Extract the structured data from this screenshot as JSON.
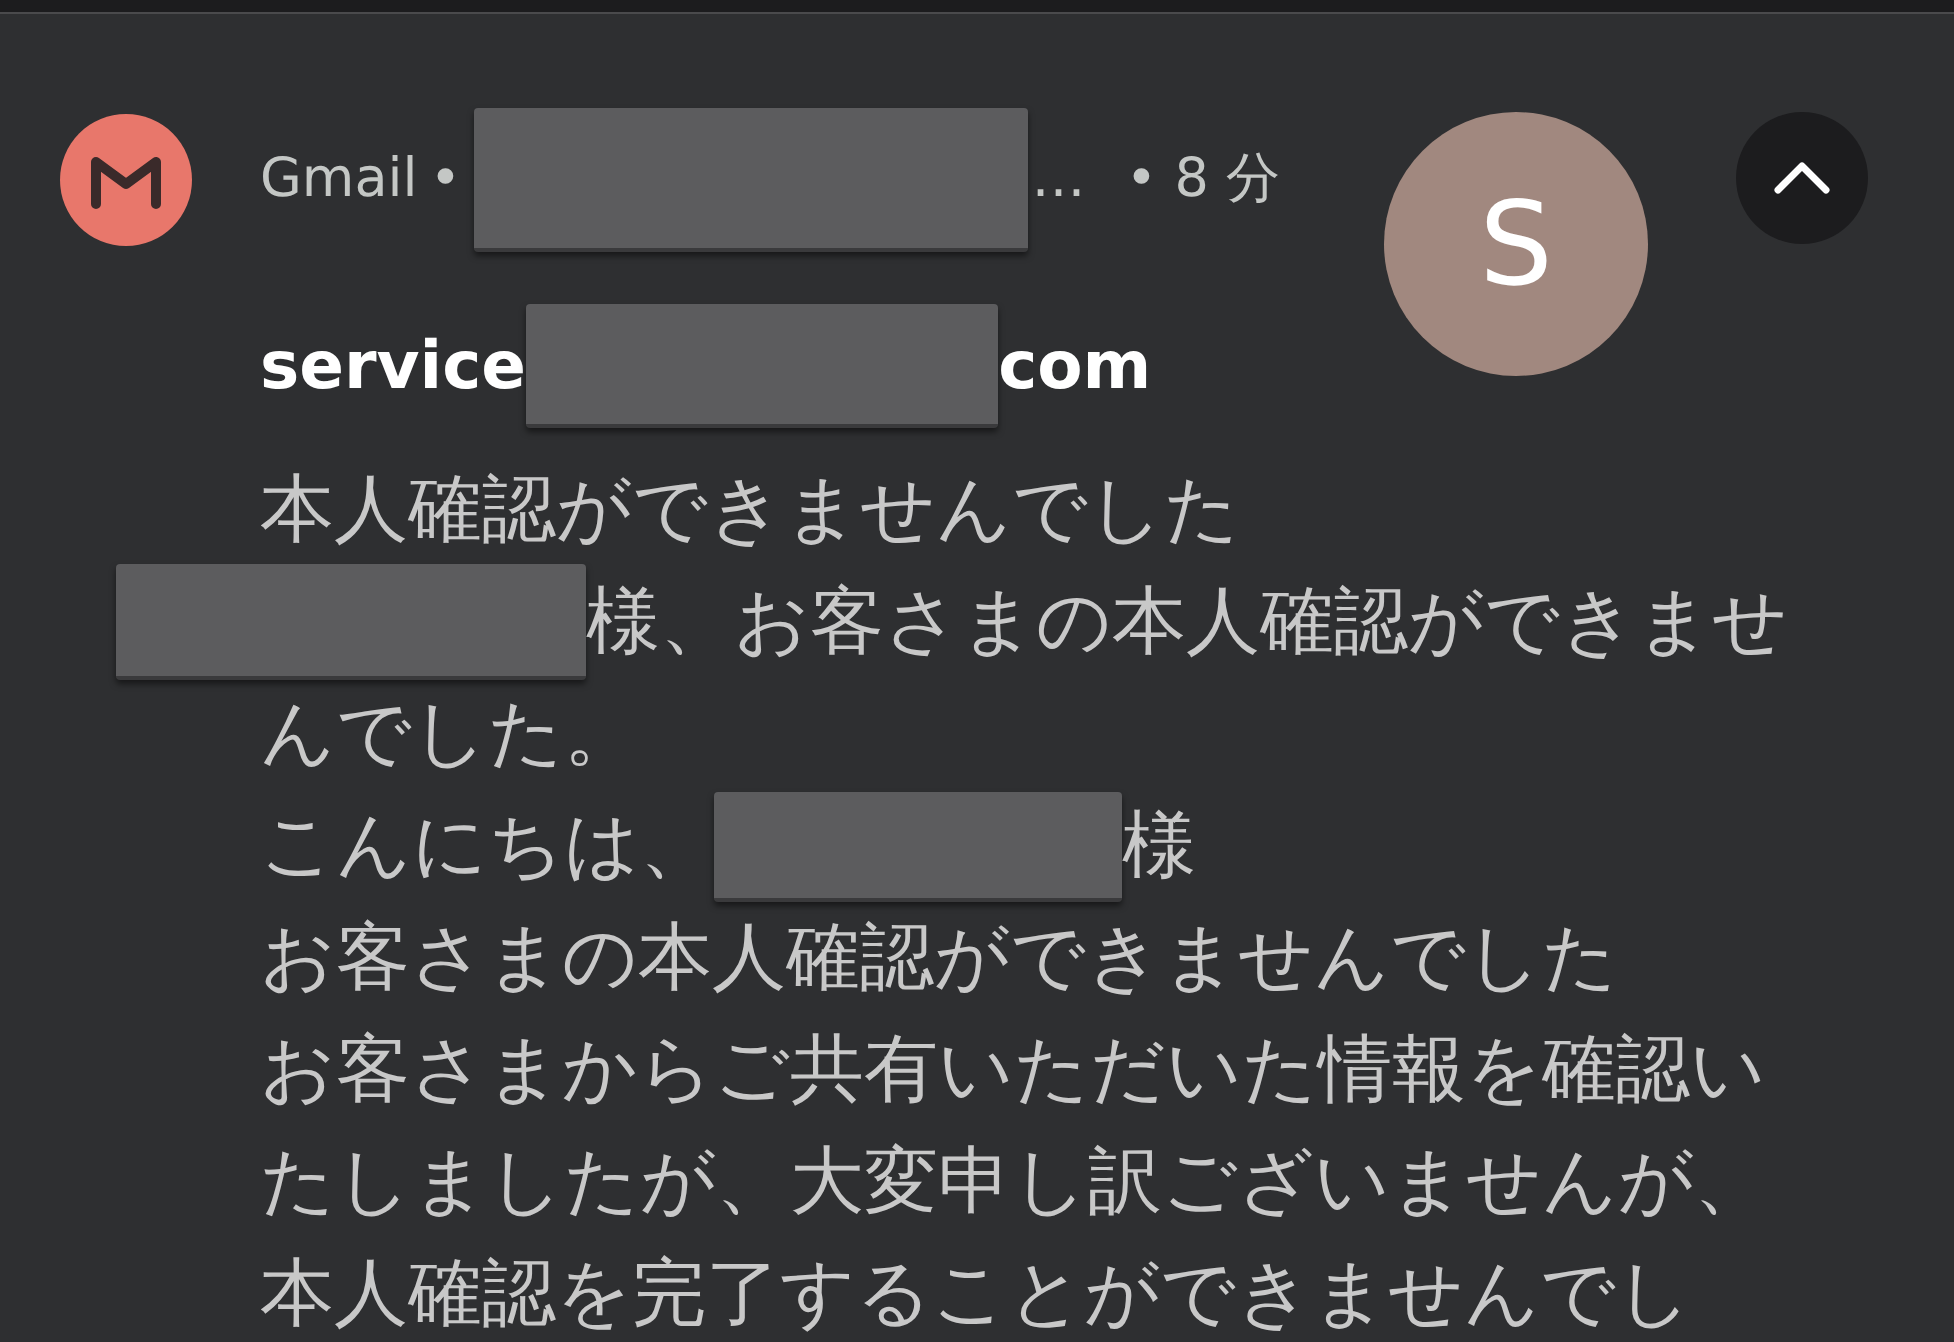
{
  "notification": {
    "app": "Gmail",
    "app_dot": "•",
    "ellipsis": "…",
    "time": "• 8 分",
    "avatar_letter": "S",
    "expanded": true,
    "title": [
      {
        "kind": "text",
        "text": "service"
      },
      {
        "kind": "redaction"
      },
      {
        "kind": "text",
        "text": "com"
      }
    ],
    "body_lines": [
      [
        {
          "kind": "text",
          "text": "本人確認ができませんでした"
        }
      ],
      [
        {
          "kind": "redaction"
        },
        {
          "kind": "text",
          "text": "様、お客さまの本人確認ができませ"
        }
      ],
      [
        {
          "kind": "text",
          "text": "んでした。"
        }
      ],
      [
        {
          "kind": "text",
          "text": "こんにちは、"
        },
        {
          "kind": "redaction"
        },
        {
          "kind": "text",
          "text": "様"
        }
      ],
      [
        {
          "kind": "text",
          "text": "お客さまの本人確認ができませんでした"
        }
      ],
      [
        {
          "kind": "text",
          "text": "お客さまからご共有いただいた情報を確認い"
        }
      ],
      [
        {
          "kind": "text",
          "text": "たしましたが、大変申し訳ございませんが、"
        }
      ],
      [
        {
          "kind": "text",
          "text": "本人確認を完了することができませんでし"
        }
      ]
    ]
  }
}
